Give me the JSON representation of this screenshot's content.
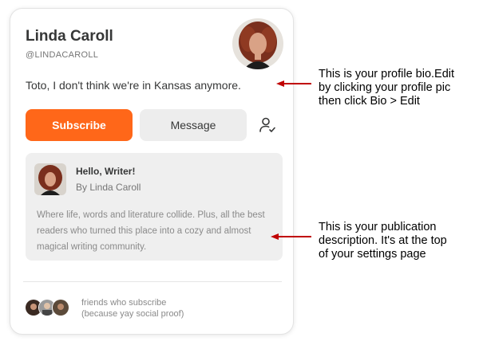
{
  "profile": {
    "name": "Linda Caroll",
    "handle": "@LINDACAROLL",
    "bio": "Toto, I don't think we're in Kansas anymore."
  },
  "actions": {
    "subscribe_label": "Subscribe",
    "message_label": "Message",
    "follow_icon": "person-check-icon"
  },
  "publication": {
    "title": "Hello, Writer!",
    "author": "By Linda Caroll",
    "description": "Where life, words and literature collide. Plus, all the best readers who turned this place into a cozy and almost magical writing community."
  },
  "friends": {
    "line1": "friends who subscribe",
    "line2": "(because yay social proof)"
  },
  "annotations": {
    "bio_note": [
      "This is your profile bio.Edit",
      "by clicking your profile pic",
      "then click Bio > Edit"
    ],
    "pub_note": [
      "This is your publication",
      "description. It's at the top",
      "of your settings page"
    ]
  },
  "colors": {
    "accent": "#ff6719",
    "arrow": "#c00000",
    "text": "#363737",
    "muted": "#757575",
    "panel": "#efefef"
  }
}
